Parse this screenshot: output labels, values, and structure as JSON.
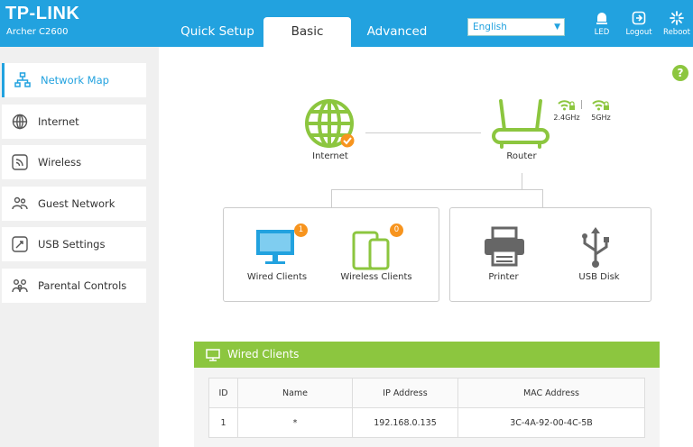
{
  "brand": {
    "logo": "TP-LINK",
    "model": "Archer C2600"
  },
  "tabs": [
    {
      "label": "Quick Setup",
      "active": false
    },
    {
      "label": "Basic",
      "active": true
    },
    {
      "label": "Advanced",
      "active": false
    }
  ],
  "language": {
    "selected": "English"
  },
  "header_buttons": {
    "led": "LED",
    "logout": "Logout",
    "reboot": "Reboot"
  },
  "sidebar": {
    "items": [
      {
        "label": "Network Map",
        "icon": "network-map-icon",
        "active": true
      },
      {
        "label": "Internet",
        "icon": "globe-icon",
        "active": false
      },
      {
        "label": "Wireless",
        "icon": "wireless-icon",
        "active": false
      },
      {
        "label": "Guest Network",
        "icon": "guest-network-icon",
        "active": false
      },
      {
        "label": "USB Settings",
        "icon": "usb-settings-icon",
        "active": false
      },
      {
        "label": "Parental Controls",
        "icon": "parental-controls-icon",
        "active": false
      }
    ]
  },
  "help": {
    "label": "?"
  },
  "network_map": {
    "internet": {
      "label": "Internet",
      "status": "connected"
    },
    "router": {
      "label": "Router",
      "band_24": "2.4GHz",
      "band_5": "5GHz"
    },
    "wired_clients": {
      "label": "Wired Clients",
      "count": "1"
    },
    "wireless_clients": {
      "label": "Wireless Clients",
      "count": "0"
    },
    "printer": {
      "label": "Printer"
    },
    "usb_disk": {
      "label": "USB Disk"
    }
  },
  "clients_panel": {
    "title": "Wired Clients",
    "columns": [
      "ID",
      "Name",
      "IP Address",
      "MAC Address"
    ],
    "rows": [
      {
        "id": "1",
        "name": "*",
        "ip": "192.168.0.135",
        "mac": "3C-4A-92-00-4C-5B"
      }
    ]
  },
  "colors": {
    "header_blue": "#22a2df",
    "accent_green": "#8cc63f",
    "badge_orange": "#f7941e",
    "icon_gray": "#555555"
  }
}
